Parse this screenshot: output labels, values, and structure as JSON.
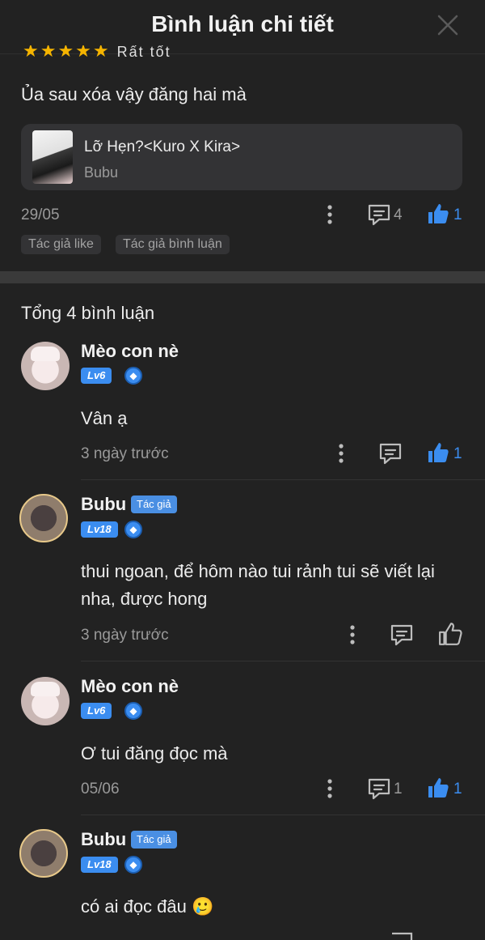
{
  "header": {
    "title": "Bình luận chi tiết"
  },
  "main_comment": {
    "rating_label": "Rất tốt",
    "text": "Ủa sau xóa vậy đăng hai mà",
    "story": {
      "title": "Lỡ Hẹn?<Kuro X Kira>",
      "author": "Bubu"
    },
    "date": "29/05",
    "reply_count": "4",
    "like_count": "1",
    "tags": [
      "Tác giả like",
      "Tác giả bình luận"
    ]
  },
  "replies_header": "Tổng 4 bình luận",
  "replies": [
    {
      "name": "Mèo con nè",
      "level": "Lv6",
      "text": "Vân ạ",
      "time": "3 ngày trước",
      "reply_count": "",
      "like_count": "1"
    },
    {
      "name": "Bubu",
      "author_badge": "Tác giả",
      "level": "Lv18",
      "text": "thui ngoan, để hôm nào tui rảnh tui sẽ viết lại nha, được hong",
      "time": "3 ngày trước",
      "reply_count": "",
      "like_count": ""
    },
    {
      "name": "Mèo con nè",
      "level": "Lv6",
      "text": "Ơ tui đăng đọc mà",
      "time": "05/06",
      "reply_count": "1",
      "like_count": "1"
    },
    {
      "name": "Bubu",
      "author_badge": "Tác giả",
      "level": "Lv18",
      "text": "có ai đọc đâu 🥲"
    }
  ],
  "colors": {
    "background": "#222222",
    "accent": "#3b8df0",
    "muted": "#9a9a9a"
  }
}
